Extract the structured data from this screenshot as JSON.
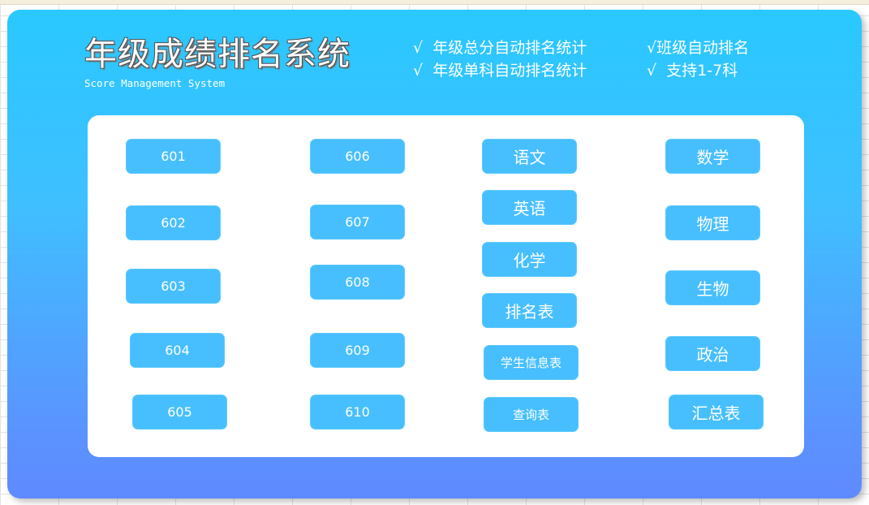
{
  "header": {
    "title": "年级成绩排名系统",
    "subtitle": "Score Management System"
  },
  "features": [
    {
      "check": "√",
      "label": "年级总分自动排名统计"
    },
    {
      "check": "√",
      "label": "年级单科自动排名统计"
    },
    {
      "check": "√",
      "label": "班级自动排名"
    },
    {
      "check": "√",
      "label": "支持1-7科"
    }
  ],
  "classes": [
    "601",
    "602",
    "603",
    "604",
    "605",
    "606",
    "607",
    "608",
    "609",
    "610"
  ],
  "subjects_col3": [
    "语文",
    "英语",
    "化学",
    "排名表",
    "学生信息表",
    "查询表"
  ],
  "subjects_col4": [
    "数学",
    "物理",
    "生物",
    "政治",
    "汇总表"
  ],
  "colors": {
    "panel_top": "#29c8ff",
    "panel_bottom": "#5f8aff",
    "button": "#47bfff"
  }
}
